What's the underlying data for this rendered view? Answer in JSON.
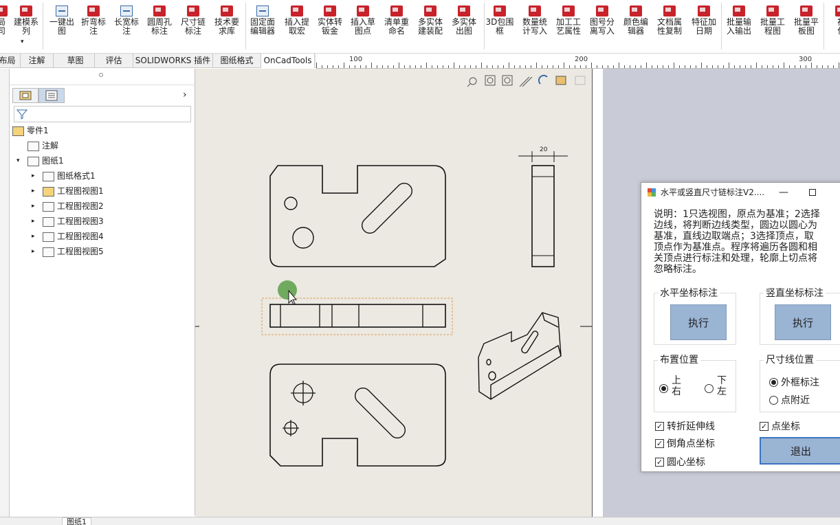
{
  "ribbon": {
    "buttons": [
      {
        "label": "局\n司",
        "icon": "red"
      },
      {
        "label": "建模系\n列",
        "icon": "red"
      },
      {
        "label": "一键出\n图",
        "icon": "blue"
      },
      {
        "label": "折弯标\n注",
        "icon": "red"
      },
      {
        "label": "长宽标\n注",
        "icon": "blue"
      },
      {
        "label": "圆周孔\n标注",
        "icon": "red"
      },
      {
        "label": "尺寸链\n标注",
        "icon": "red"
      },
      {
        "label": "技术要\n求库",
        "icon": "red"
      },
      {
        "label": "固定面\n编辑器",
        "icon": "blue"
      },
      {
        "label": "插入提\n取宏",
        "icon": "red"
      },
      {
        "label": "实体转\n钣金",
        "icon": "red"
      },
      {
        "label": "插入草\n图点",
        "icon": "red"
      },
      {
        "label": "清单重\n命名",
        "icon": "red"
      },
      {
        "label": "多实体\n建装配",
        "icon": "red"
      },
      {
        "label": "多实体\n出图",
        "icon": "red"
      },
      {
        "label": "3D包围\n框",
        "icon": "red"
      },
      {
        "label": "数量统\n计写入",
        "icon": "red"
      },
      {
        "label": "加工工\n艺属性",
        "icon": "red"
      },
      {
        "label": "图号分\n离写入",
        "icon": "red"
      },
      {
        "label": "颜色编\n辑器",
        "icon": "red"
      },
      {
        "label": "文档属\n性复制",
        "icon": "red"
      },
      {
        "label": "特征加\n日期",
        "icon": "red"
      },
      {
        "label": "批量输\n入输出",
        "icon": "red"
      },
      {
        "label": "批量工\n程图",
        "icon": "red"
      },
      {
        "label": "批量平\n板图",
        "icon": "red"
      },
      {
        "label": "视\n化",
        "icon": "red"
      }
    ]
  },
  "tabs": [
    "布局",
    "注解",
    "草图",
    "评估",
    "SOLIDWORKS 插件",
    "图纸格式",
    "OnCadTools"
  ],
  "active_tab": "OnCadTools",
  "ruler": {
    "labels": [
      "100",
      "200",
      "300"
    ]
  },
  "tree": {
    "root": "零件1",
    "items": [
      {
        "label": "注解",
        "level": 1
      },
      {
        "label": "图纸1",
        "level": 1
      },
      {
        "label": "图纸格式1",
        "level": 2
      },
      {
        "label": "工程图视图1",
        "level": 2
      },
      {
        "label": "工程图视图2",
        "level": 2
      },
      {
        "label": "工程图视图3",
        "level": 2
      },
      {
        "label": "工程图视图4",
        "level": 2
      },
      {
        "label": "工程图视图5",
        "level": 2
      }
    ]
  },
  "drawing": {
    "dimension_label": "20"
  },
  "dialog": {
    "title": "水平或竖直尺寸链标注V2....",
    "description": [
      "说明：1只选视图，原点为基准；2选择",
      "边线，将判断边线类型，圆边以圆心为",
      "基准，直线边取端点；3选择顶点，取",
      "顶点作为基准点。程序将遍历各圆和相",
      "关顶点进行标注和处理，轮廓上切点将",
      "忽略标注。"
    ],
    "horizontal_group": "水平坐标标注",
    "vertical_group": "竖直坐标标注",
    "execute_label": "执行",
    "layout_group": "布置位置",
    "layout_opt1": "上\n右",
    "layout_opt2": "下\n左",
    "dimline_group": "尺寸线位置",
    "dimline_opt1": "外框标注",
    "dimline_opt2": "点附近",
    "chk_fold": "转折延伸线",
    "chk_point": "点坐标",
    "chk_chamfer": "倒角点坐标",
    "chk_center": "圆心坐标",
    "exit_label": "退出"
  },
  "bottom": {
    "sheet_tab": "图纸1"
  }
}
